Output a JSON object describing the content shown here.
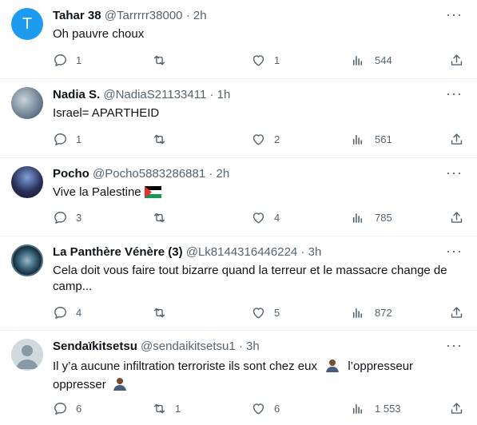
{
  "tweets": [
    {
      "name": "Tahar 38",
      "handle": "@Tarrrrr38000",
      "sep": "·",
      "time": "2h",
      "text_lines": [
        "Oh pauvre choux"
      ],
      "replies": "1",
      "retweets": "",
      "likes": "1",
      "views": "544",
      "avatar": {
        "type": "initial",
        "initial": "T",
        "color": "#1d9bf0"
      }
    },
    {
      "name": "Nadia S.",
      "handle": "@NadiaS21133411",
      "sep": "·",
      "time": "1h",
      "text_lines": [
        "Israel= APARTHEID"
      ],
      "replies": "1",
      "retweets": "",
      "likes": "2",
      "views": "561",
      "avatar": {
        "type": "photo",
        "color": "#8ca0b8"
      }
    },
    {
      "name": "Pocho",
      "handle": "@Pocho5883286881",
      "sep": "·",
      "time": "2h",
      "text_lines": [
        "Vive la Palestine"
      ],
      "flag_icon": "palestine-flag-icon",
      "replies": "3",
      "retweets": "",
      "likes": "4",
      "views": "785",
      "avatar": {
        "type": "photo",
        "color": "#2a2f5a"
      }
    },
    {
      "name": "La Panthère Vénère (3)",
      "handle": "@Lk8144316446224",
      "sep": "·",
      "time": "3h",
      "text_lines": [
        "Cela doit vous faire tout bizarre quand la terreur et le massacre change de",
        "camp..."
      ],
      "replies": "4",
      "retweets": "",
      "likes": "5",
      "views": "872",
      "avatar": {
        "type": "photo",
        "color": "#1a3b52"
      }
    },
    {
      "name": "Sendaïkitsetsu",
      "handle": "@sendaikitsetsu1",
      "sep": "·",
      "time": "3h",
      "text_lines": [
        "Il y’a aucune infiltration terroriste ils sont chez eux",
        "l’oppresseur",
        "oppresser"
      ],
      "emoji_icon": "person-bowing-emoji-icon",
      "replies": "6",
      "retweets": "1",
      "likes": "6",
      "views": "1 553",
      "avatar": {
        "type": "default",
        "color": "#cfd9de"
      }
    }
  ],
  "more_label": "···",
  "colors": {
    "muted": "#536471",
    "text": "#0f1419",
    "divider": "#eff3f4"
  }
}
